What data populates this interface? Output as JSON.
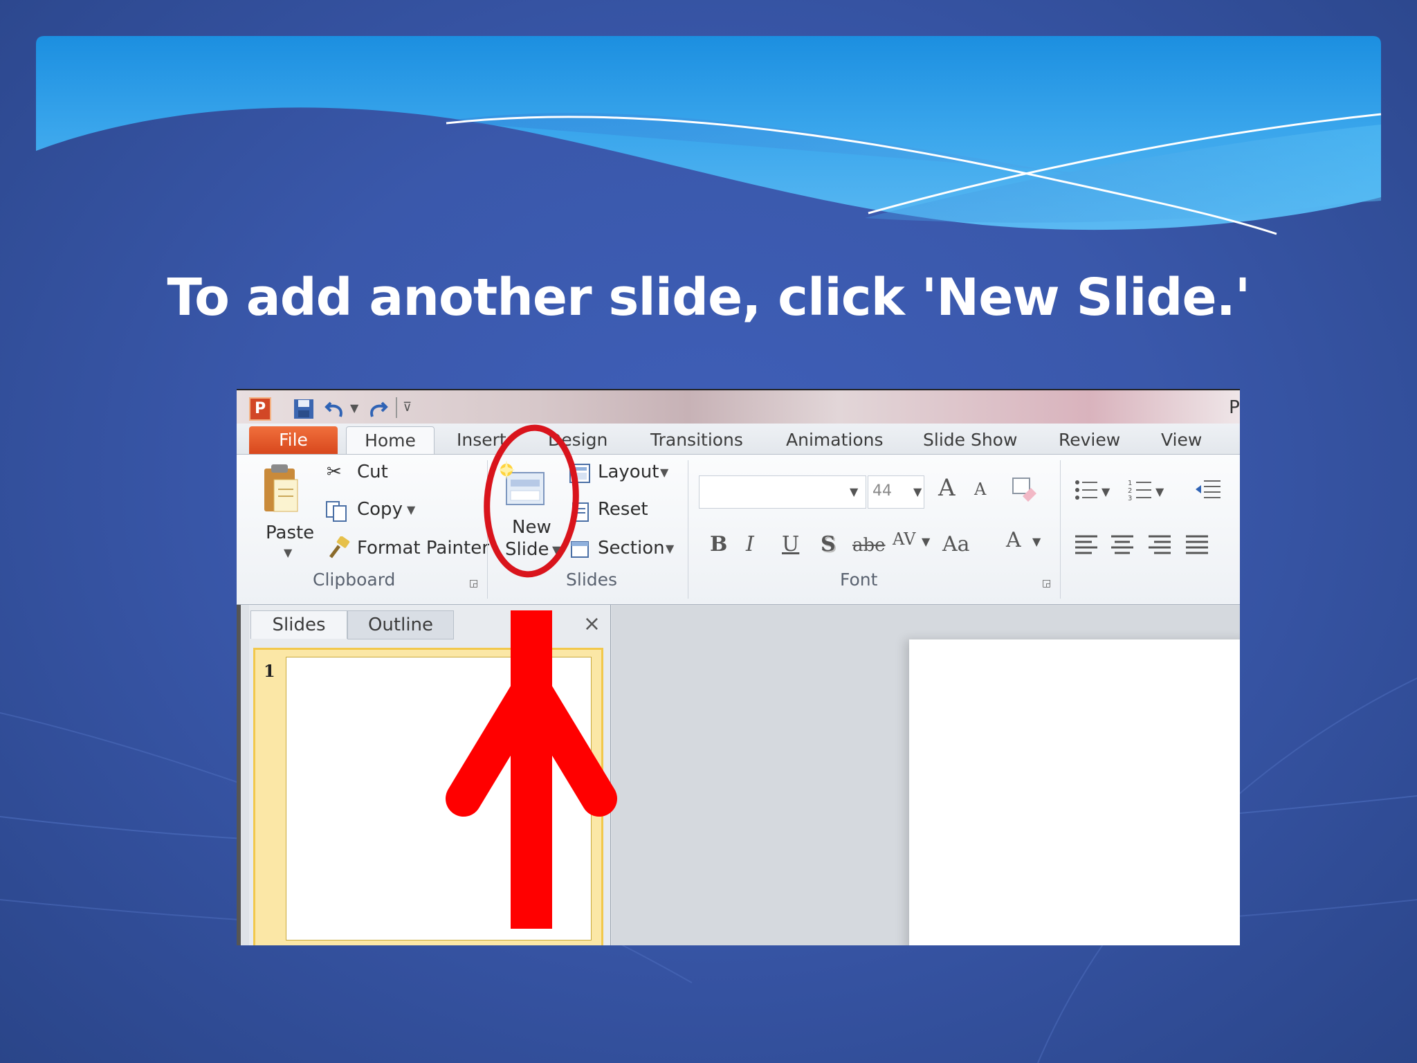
{
  "slide": {
    "title": "To add another slide, click 'New Slide.'"
  },
  "app": {
    "icon_letter": "P",
    "title_partial": "Pr",
    "tabs": [
      "File",
      "Home",
      "Insert",
      "Design",
      "Transitions",
      "Animations",
      "Slide Show",
      "Review",
      "View"
    ],
    "active_tab": "Home",
    "ribbon": {
      "clipboard": {
        "paste_label": "Paste",
        "cut_label": "Cut",
        "copy_label": "Copy",
        "format_painter_label": "Format Painter",
        "group_label": "Clipboard"
      },
      "slides": {
        "new_slide_label_1": "New",
        "new_slide_label_2": "Slide",
        "layout_label": "Layout",
        "reset_label": "Reset",
        "section_label": "Section",
        "group_label": "Slides"
      },
      "font": {
        "font_name": "",
        "font_size": "44",
        "grow_label": "A",
        "shrink_label": "A",
        "bold": "B",
        "italic": "I",
        "underline": "U",
        "shadow": "S",
        "strike": "abe",
        "spacing": "AV",
        "change_case": "Aa",
        "font_color": "A",
        "group_label": "Font"
      }
    },
    "pane": {
      "tab_slides": "Slides",
      "tab_outline": "Outline",
      "close_glyph": "×",
      "thumbnail_number": "1"
    }
  },
  "annotation": {
    "color": "#ff0000",
    "highlight": "new-slide-button"
  }
}
